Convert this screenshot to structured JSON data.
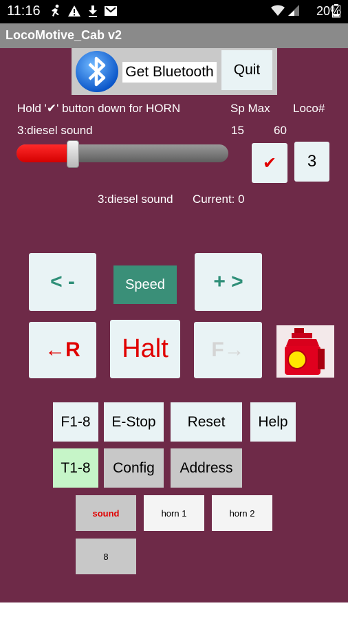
{
  "status_bar": {
    "time": "11:16",
    "battery": "20%",
    "icons": [
      "running-icon",
      "warning-icon",
      "download-icon",
      "mail-icon",
      "wifi-icon",
      "signal-icon",
      "battery-icon"
    ]
  },
  "app": {
    "title": "LocoMotive_Cab v2"
  },
  "bluetooth": {
    "label": "Get Bluetooth",
    "quit": "Quit",
    "logo_color": "#1a73e8"
  },
  "info": {
    "horn_hint": "Hold '✔' button down for HORN",
    "sp_max_label": "Sp Max",
    "loco_label": "Loco#",
    "current_loco": "3:diesel sound",
    "sp_value": "15",
    "max_value": "60",
    "check": "✔",
    "loco_number": "3",
    "status_loco": "3:diesel sound",
    "status_current": "Current: 0"
  },
  "slider": {
    "value": 15,
    "max": 60
  },
  "controls": {
    "minus": "< -",
    "speed": "Speed",
    "plus": "+ >",
    "reverse": "←R",
    "halt": "Halt",
    "forward": "F→"
  },
  "buttons": {
    "f1_8": "F1-8",
    "estop": "E-Stop",
    "reset": "Reset",
    "help": "Help",
    "t1_8": "T1-8",
    "config": "Config",
    "address": "Address",
    "sound": "sound",
    "horn1": "horn 1",
    "horn2": "horn 2",
    "eight": "8"
  },
  "colors": {
    "background": "#6e2a48",
    "accent_teal": "#3a8f78",
    "alert_red": "#e00000",
    "button_light": "#e9f3f5",
    "button_gray": "#c8c8c8",
    "button_green": "#c6f5c8"
  }
}
